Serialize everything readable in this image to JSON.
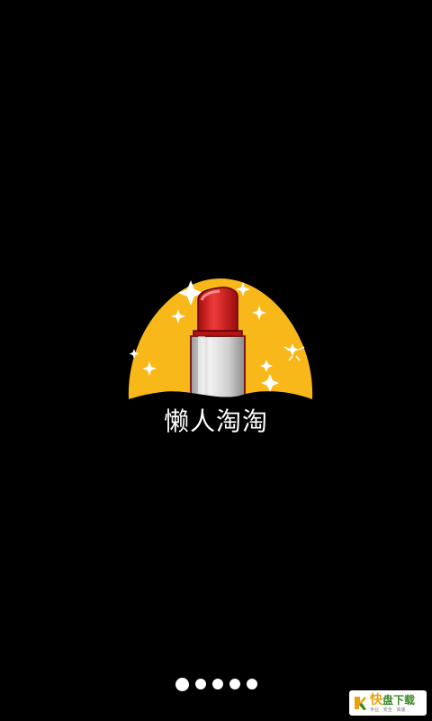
{
  "splash": {
    "app_name": "懒人淘淘",
    "background_color": "#000000",
    "logo": {
      "icon": "lipstick-icon",
      "badge_color": "#f9b81a",
      "lipstick_color": "#d21f1f",
      "decoration_icon": "sparkle-icon"
    }
  },
  "pager": {
    "page_count": 5,
    "current_page": 1
  },
  "watermark": {
    "icon": "k-logo-icon",
    "title_first": "快",
    "title_rest": "盘下载",
    "subtitle": "专业 · 安全 · 高速"
  }
}
